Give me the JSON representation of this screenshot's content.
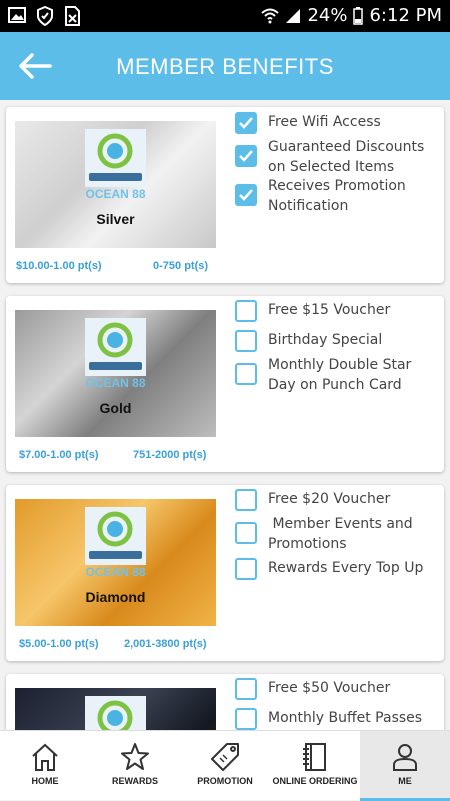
{
  "status": {
    "battery": "24%",
    "time": "6:12 PM"
  },
  "header": {
    "title": "MEMBER BENEFITS"
  },
  "tiers": [
    {
      "name": "Silver",
      "logo_text": "OCEAN 88",
      "price_rate": "$10.00-1.00 pt(s)",
      "points_range": "0-750 pt(s)",
      "benefits": [
        {
          "label": "Free Wifi Access",
          "checked": true
        },
        {
          "label": "Guaranteed Discounts on Selected Items",
          "checked": true
        },
        {
          "label": "Receives Promotion Notification",
          "checked": true
        }
      ]
    },
    {
      "name": "Gold",
      "logo_text": "OCEAN 88",
      "price_rate": "$7.00-1.00 pt(s)",
      "points_range": "751-2000 pt(s)",
      "benefits": [
        {
          "label": "Free $15 Voucher",
          "checked": false
        },
        {
          "label": "Birthday Special",
          "checked": false
        },
        {
          "label": "Monthly Double Star Day on Punch Card",
          "checked": false
        }
      ]
    },
    {
      "name": "Diamond",
      "logo_text": "OCEAN 88",
      "price_rate": "$5.00-1.00 pt(s)",
      "points_range": "2,001-3800 pt(s)",
      "benefits": [
        {
          "label": "Free $20 Voucher",
          "checked": false
        },
        {
          "label": " Member Events and Promotions",
          "checked": false
        },
        {
          "label": "Rewards Every Top Up",
          "checked": false
        }
      ]
    },
    {
      "name": "",
      "logo_text": "",
      "price_rate": "",
      "points_range": "",
      "benefits": [
        {
          "label": "Free $50 Voucher",
          "checked": false
        },
        {
          "label": "Monthly Buffet Passes",
          "checked": false
        }
      ]
    }
  ],
  "nav": [
    {
      "label": "HOME",
      "icon": "home-icon"
    },
    {
      "label": "REWARDS",
      "icon": "star-icon"
    },
    {
      "label": "PROMOTION",
      "icon": "tag-icon"
    },
    {
      "label": "ONLINE ORDERING",
      "icon": "notebook-icon"
    },
    {
      "label": "ME",
      "icon": "person-icon",
      "active": true
    }
  ],
  "colors": {
    "accent": "#5cbde9",
    "status_bar": "#000000",
    "price_text": "#3aa0d8"
  }
}
